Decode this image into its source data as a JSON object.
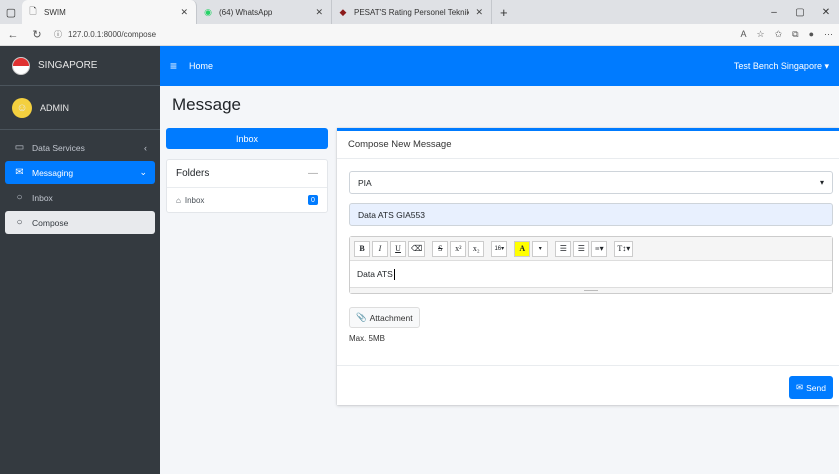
{
  "browser": {
    "tabs": [
      {
        "label": "SWIM",
        "icon": "document-icon"
      },
      {
        "label": "(64) WhatsApp",
        "icon": "whatsapp-icon"
      },
      {
        "label": "PESAT'S Rating Personel Teknik T",
        "icon": "pesat-icon"
      }
    ],
    "url": "127.0.0.1:8000/compose",
    "colors": {
      "whatsapp": "#25d366",
      "pesat": "#8b1a1a"
    }
  },
  "sidebar": {
    "brand": "SINGAPORE",
    "user": "ADMIN",
    "items": [
      {
        "label": "Data Services"
      },
      {
        "label": "Messaging"
      },
      {
        "label": "Inbox"
      },
      {
        "label": "Compose"
      }
    ]
  },
  "navbar": {
    "home": "Home",
    "account": "Test Bench Singapore"
  },
  "main": {
    "title": "Message",
    "inbox_button": "Inbox",
    "folders": {
      "title": "Folders",
      "items": [
        {
          "label": "Inbox",
          "count": "0"
        }
      ]
    },
    "compose": {
      "title": "Compose New Message",
      "recipient": "PIA",
      "subject": "Data ATS GIA553",
      "toolbar": {
        "bold": "B",
        "italic": "I",
        "underline": "U",
        "eraser": "⌫",
        "strike": "S",
        "sup": "x²",
        "sub": "x₂",
        "fontsize": "16",
        "color": "A",
        "ul": "☰",
        "ol": "☰",
        "align": "≡",
        "height": "T↕"
      },
      "body": "Data ATS",
      "attachment_label": "Attachment",
      "max_size": "Max. 5MB",
      "send_label": "Send"
    }
  },
  "accent_color": "#007bff"
}
